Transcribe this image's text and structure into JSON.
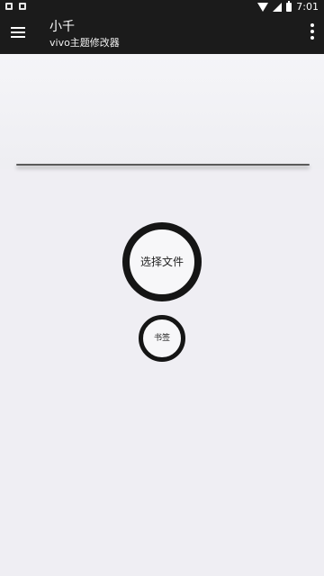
{
  "status_bar": {
    "time": "7:01"
  },
  "app_bar": {
    "title": "小千",
    "subtitle": "vivo主题修改器"
  },
  "buttons": {
    "select_file": "选择文件",
    "bookmark": "书签"
  },
  "icons": {
    "menu": "menu-icon",
    "more": "more-vert-icon"
  },
  "colors": {
    "app_bar": "#1b1b1b",
    "background": "#efeef3",
    "circle_border": "#151515"
  }
}
